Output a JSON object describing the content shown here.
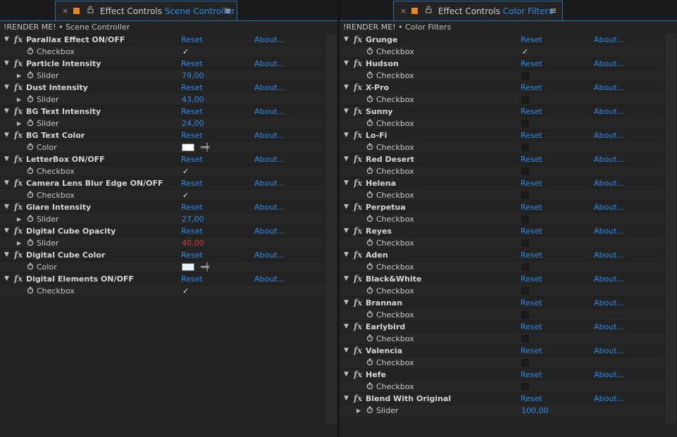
{
  "colors": {
    "accent": "#2d8ceb",
    "tab_border": "#2e6ea5",
    "warning_value": "#d23a32",
    "label_swatch": "#e8861c"
  },
  "left": {
    "tab": {
      "close": "×",
      "title_prefix": "Effect Controls",
      "title_comp": "Scene Controller",
      "menu": "≡"
    },
    "breadcrumb": "!RENDER ME! • Scene Controller",
    "effects": [
      {
        "name": "Parallax Effect ON/OFF",
        "reset": "Reset",
        "about": "About...",
        "param": "Checkbox",
        "kind": "checkbox",
        "checked": true
      },
      {
        "name": "Particle Intensity",
        "reset": "Reset",
        "about": "About...",
        "param": "Slider",
        "kind": "slider",
        "value": "79,00"
      },
      {
        "name": "Dust Intensity",
        "reset": "Reset",
        "about": "About...",
        "param": "Slider",
        "kind": "slider",
        "value": "43,00"
      },
      {
        "name": "BG Text Intensity",
        "reset": "Reset",
        "about": "About...",
        "param": "Slider",
        "kind": "slider",
        "value": "24,00"
      },
      {
        "name": "BG Text Color",
        "reset": "Reset",
        "about": "About...",
        "param": "Color",
        "kind": "color",
        "color": "#ffffff"
      },
      {
        "name": "LetterBox ON/OFF",
        "reset": "Reset",
        "about": "About...",
        "param": "Checkbox",
        "kind": "checkbox",
        "checked": true
      },
      {
        "name": "Camera Lens Blur Edge ON/OFF",
        "reset": "Reset",
        "about": "About...",
        "param": "Checkbox",
        "kind": "checkbox",
        "checked": true
      },
      {
        "name": "Glare Intensity",
        "reset": "Reset",
        "about": "About...",
        "param": "Slider",
        "kind": "slider",
        "value": "27,00"
      },
      {
        "name": "Digital Cube Opacity",
        "reset": "Reset",
        "about": "About...",
        "param": "Slider",
        "kind": "slider",
        "value": "40,00",
        "red": true
      },
      {
        "name": "Digital Cube Color",
        "reset": "Reset",
        "about": "About...",
        "param": "Color",
        "kind": "color",
        "color": "#e4f4fa"
      },
      {
        "name": "Digital Elements ON/OFF",
        "reset": "Reset",
        "about": "About...",
        "param": "Checkbox",
        "kind": "checkbox",
        "checked": true
      }
    ]
  },
  "right": {
    "tab": {
      "close": "×",
      "title_prefix": "Effect Controls",
      "title_comp": "Color Filters",
      "menu": "≡"
    },
    "breadcrumb": "!RENDER ME! • Color Filters",
    "effects": [
      {
        "name": "Grunge",
        "reset": "Reset",
        "about": "About...",
        "param": "Checkbox",
        "kind": "checkbox",
        "checked": true
      },
      {
        "name": "Hudson",
        "reset": "Reset",
        "about": "About...",
        "param": "Checkbox",
        "kind": "checkbox",
        "checked": false
      },
      {
        "name": "X-Pro",
        "reset": "Reset",
        "about": "About...",
        "param": "Checkbox",
        "kind": "checkbox",
        "checked": false
      },
      {
        "name": "Sunny",
        "reset": "Reset",
        "about": "About...",
        "param": "Checkbox",
        "kind": "checkbox",
        "checked": false
      },
      {
        "name": "Lo-Fi",
        "reset": "Reset",
        "about": "About...",
        "param": "Checkbox",
        "kind": "checkbox",
        "checked": false
      },
      {
        "name": "Red Desert",
        "reset": "Reset",
        "about": "About...",
        "param": "Checkbox",
        "kind": "checkbox",
        "checked": false
      },
      {
        "name": "Helena",
        "reset": "Reset",
        "about": "About...",
        "param": "Checkbox",
        "kind": "checkbox",
        "checked": false
      },
      {
        "name": "Perpetua",
        "reset": "Reset",
        "about": "About...",
        "param": "Checkbox",
        "kind": "checkbox",
        "checked": false
      },
      {
        "name": "Reyes",
        "reset": "Reset",
        "about": "About...",
        "param": "Checkbox",
        "kind": "checkbox",
        "checked": false
      },
      {
        "name": "Aden",
        "reset": "Reset",
        "about": "About...",
        "param": "Checkbox",
        "kind": "checkbox",
        "checked": false
      },
      {
        "name": "Black&White",
        "reset": "Reset",
        "about": "About...",
        "param": "Checkbox",
        "kind": "checkbox",
        "checked": false
      },
      {
        "name": "Brannan",
        "reset": "Reset",
        "about": "About...",
        "param": "Checkbox",
        "kind": "checkbox",
        "checked": false
      },
      {
        "name": "Earlybird",
        "reset": "Reset",
        "about": "About...",
        "param": "Checkbox",
        "kind": "checkbox",
        "checked": false
      },
      {
        "name": "Valencia",
        "reset": "Reset",
        "about": "About...",
        "param": "Checkbox",
        "kind": "checkbox",
        "checked": false
      },
      {
        "name": "Hefe",
        "reset": "Reset",
        "about": "About...",
        "param": "Checkbox",
        "kind": "checkbox",
        "checked": false
      },
      {
        "name": "Blend With Original",
        "reset": "Reset",
        "about": "About...",
        "param": "Slider",
        "kind": "slider",
        "value": "100,00"
      }
    ]
  }
}
